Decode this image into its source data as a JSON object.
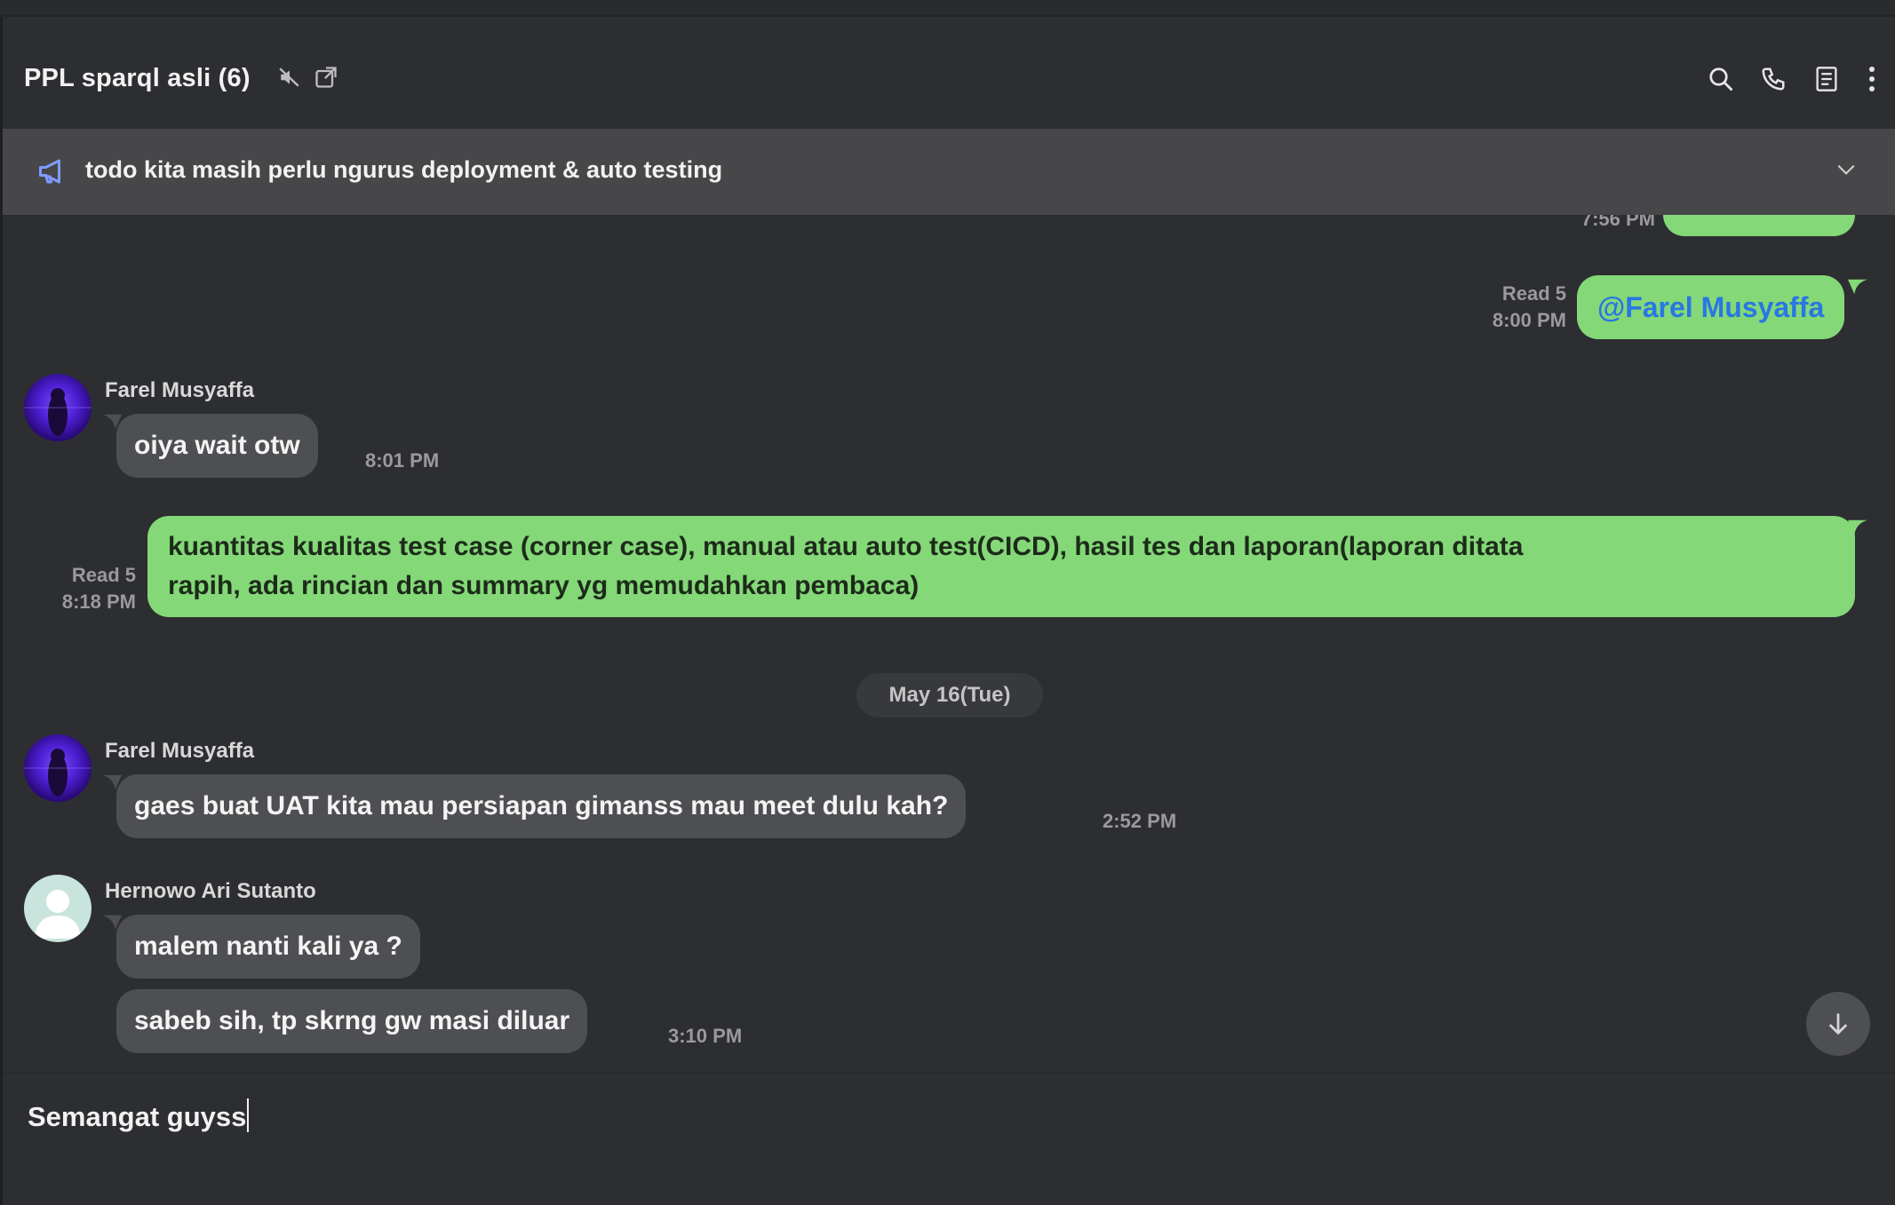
{
  "header": {
    "title": "PPL sparql asli (6)",
    "icons": [
      "mute-icon",
      "popout-icon",
      "search-icon",
      "call-icon",
      "notes-icon",
      "more-icon"
    ]
  },
  "announcement": {
    "text": "todo kita masih perlu ngurus deployment & auto testing",
    "icon": "megaphone-icon"
  },
  "messages": [
    {
      "type": "out",
      "time": "7:56 PM",
      "partial": true
    },
    {
      "type": "out",
      "read": "Read 5",
      "time": "8:00 PM",
      "text": "@Farel Musyaffa"
    },
    {
      "type": "in",
      "sender": "Farel Musyaffa",
      "text": "oiya wait otw",
      "time": "8:01 PM"
    },
    {
      "type": "out",
      "read": "Read 5",
      "time": "8:18 PM",
      "line1": "kuantitas kualitas test case (corner case), manual atau auto test(CICD), hasil tes dan laporan(laporan ditata",
      "line2": "rapih, ada rincian dan summary yg memudahkan pembaca)"
    },
    {
      "type": "date",
      "text": "May 16(Tue)"
    },
    {
      "type": "in",
      "sender": "Farel Musyaffa",
      "text": "gaes buat UAT kita mau persiapan gimanss mau meet dulu kah?",
      "time": "2:52 PM"
    },
    {
      "type": "in",
      "sender": "Hernowo Ari Sutanto",
      "text": "malem nanti kali ya ?"
    },
    {
      "type": "in",
      "text": "sabeb sih, tp skrng gw masi diluar",
      "time": "3:10 PM"
    }
  ],
  "input": {
    "value": "Semangat guyss"
  },
  "colors": {
    "outgoing": "#84d878",
    "incoming": "#4e4f52",
    "mention": "#2877e2",
    "background": "#2d2e31"
  }
}
